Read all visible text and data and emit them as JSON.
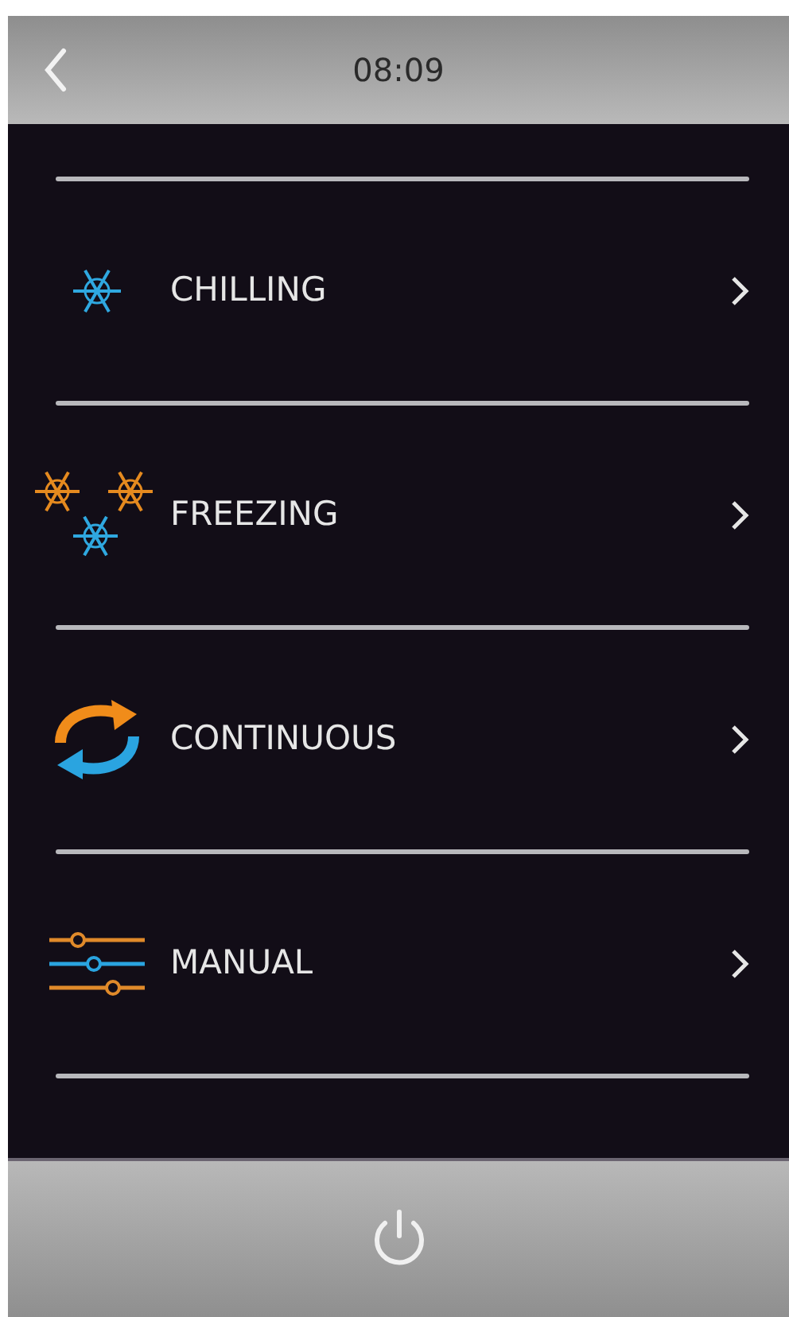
{
  "header": {
    "time": "08:09"
  },
  "menu": [
    {
      "kind": "chill",
      "label": "CHILLING"
    },
    {
      "kind": "freeze",
      "label": "FREEZING"
    },
    {
      "kind": "continuous",
      "label": "CONTINUOUS"
    },
    {
      "kind": "manual",
      "label": "MANUAL"
    }
  ]
}
